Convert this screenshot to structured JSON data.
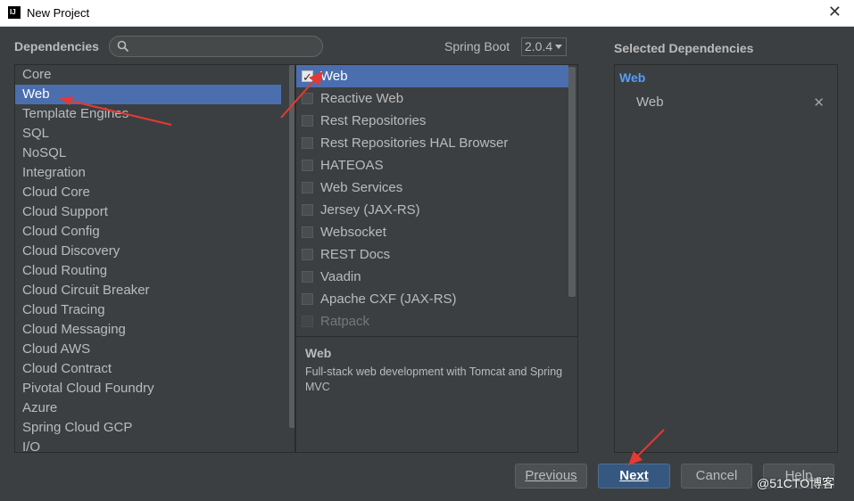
{
  "window": {
    "title": "New Project",
    "app_icon": "IJ"
  },
  "header": {
    "dependencies_label": "Dependencies",
    "search": {
      "value": "",
      "placeholder": ""
    },
    "spring_boot_label": "Spring Boot",
    "spring_boot_version": "2.0.4",
    "selected_title": "Selected Dependencies"
  },
  "categories": [
    {
      "label": "Core"
    },
    {
      "label": "Web"
    },
    {
      "label": "Template Engines"
    },
    {
      "label": "SQL"
    },
    {
      "label": "NoSQL"
    },
    {
      "label": "Integration"
    },
    {
      "label": "Cloud Core"
    },
    {
      "label": "Cloud Support"
    },
    {
      "label": "Cloud Config"
    },
    {
      "label": "Cloud Discovery"
    },
    {
      "label": "Cloud Routing"
    },
    {
      "label": "Cloud Circuit Breaker"
    },
    {
      "label": "Cloud Tracing"
    },
    {
      "label": "Cloud Messaging"
    },
    {
      "label": "Cloud AWS"
    },
    {
      "label": "Cloud Contract"
    },
    {
      "label": "Pivotal Cloud Foundry"
    },
    {
      "label": "Azure"
    },
    {
      "label": "Spring Cloud GCP"
    },
    {
      "label": "I/O"
    }
  ],
  "selected_category": "Web",
  "dependencies": [
    {
      "label": "Web",
      "checked": true
    },
    {
      "label": "Reactive Web",
      "checked": false
    },
    {
      "label": "Rest Repositories",
      "checked": false
    },
    {
      "label": "Rest Repositories HAL Browser",
      "checked": false
    },
    {
      "label": "HATEOAS",
      "checked": false
    },
    {
      "label": "Web Services",
      "checked": false
    },
    {
      "label": "Jersey (JAX-RS)",
      "checked": false
    },
    {
      "label": "Websocket",
      "checked": false
    },
    {
      "label": "REST Docs",
      "checked": false
    },
    {
      "label": "Vaadin",
      "checked": false
    },
    {
      "label": "Apache CXF (JAX-RS)",
      "checked": false
    },
    {
      "label": "Ratpack",
      "checked": false
    }
  ],
  "description": {
    "title": "Web",
    "text": "Full-stack web development with Tomcat and Spring MVC"
  },
  "selected": {
    "group": "Web",
    "items": [
      {
        "label": "Web",
        "remove_icon": "close-icon"
      }
    ]
  },
  "buttons": {
    "previous": "Previous",
    "next": "Next",
    "cancel": "Cancel",
    "help": "Help"
  },
  "watermark": "@51CTO博客",
  "colors": {
    "selection": "#4b6eaf",
    "default_button": "#365880",
    "annotation_arrow": "#e53935",
    "group_title": "#589df6"
  }
}
